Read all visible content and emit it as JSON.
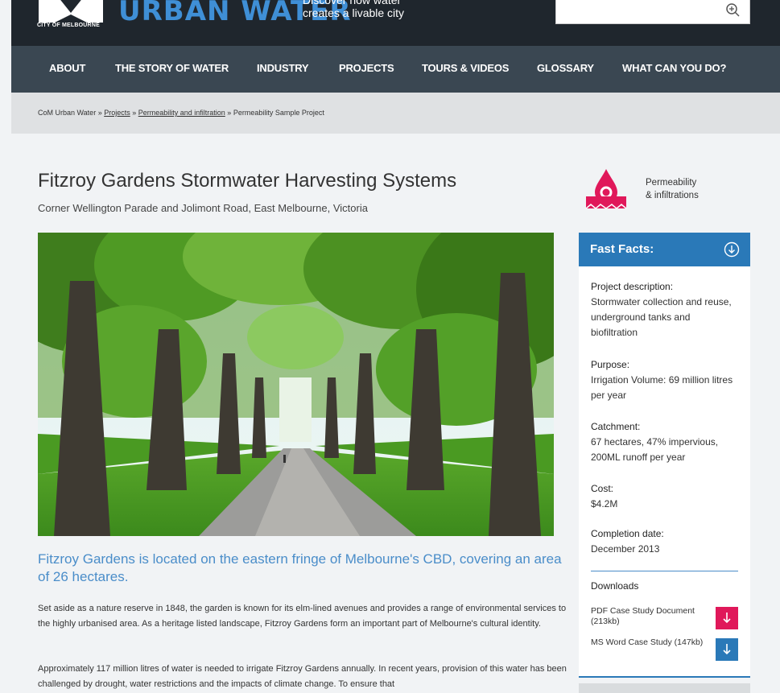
{
  "header": {
    "logo_text": "CITY OF MELBOURNE",
    "site_title": "URBAN WATER",
    "tagline_line1": "Discover how water",
    "tagline_line2": "creates a livable city",
    "search_placeholder": "",
    "search_icon": "zoom-in-icon"
  },
  "nav": {
    "items": [
      {
        "label": "ABOUT"
      },
      {
        "label": "THE STORY OF WATER"
      },
      {
        "label": "INDUSTRY"
      },
      {
        "label": "PROJECTS"
      },
      {
        "label": "TOURS & VIDEOS"
      },
      {
        "label": "GLOSSARY"
      },
      {
        "label": "WHAT CAN YOU DO?"
      }
    ]
  },
  "breadcrumb": {
    "root": "CoM Urban Water",
    "sep": " » ",
    "projects": "Projects",
    "category": "Permeability and infiltration",
    "current": "Permeability Sample Project"
  },
  "page": {
    "title": "Fitzroy Gardens Stormwater Harvesting Systems",
    "subtitle": "Corner Wellington Parade and Jolimont Road, East Melbourne, Victoria",
    "lead": "Fitzroy Gardens is located on the eastern fringe of Melbourne's CBD, covering an area of 26 hectares.",
    "para1": "Set aside as a nature reserve in 1848, the garden is known for its elm-lined avenues and provides a range of environmental services to the highly urbanised area. As a heritage listed landscape, Fitzroy Gardens form an important part of Melbourne's cultural identity.",
    "para2": "Approximately 117 million litres of water is needed to irrigate Fitzroy Gardens annually. In recent years, provision of this water has been challenged by drought, water restrictions and the impacts of climate change. To ensure that"
  },
  "category": {
    "line1": "Permeability",
    "line2": "& infiltrations",
    "color": "#e0185a"
  },
  "facts": {
    "title": "Fast Facts:",
    "color": "#2a79b8",
    "description_label": "Project description:",
    "description_value": "Stormwater collection and reuse, underground tanks and biofiltration",
    "purpose_label": "Purpose:",
    "purpose_value": "Irrigation Volume: 69 million litres per year",
    "catchment_label": "Catchment:",
    "catchment_value": "67 hectares, 47% impervious, 200ML runoff per year",
    "cost_label": "Cost:",
    "cost_value": "$4.2M",
    "completion_label": "Completion date:",
    "completion_value": "December 2013",
    "downloads_title": "Downloads",
    "pdf_label": "PDF Case Study Document (213kb)",
    "word_label": "MS Word Case Study (147kb)",
    "pdf_color": "#e0185a",
    "word_color": "#2a79b8"
  }
}
